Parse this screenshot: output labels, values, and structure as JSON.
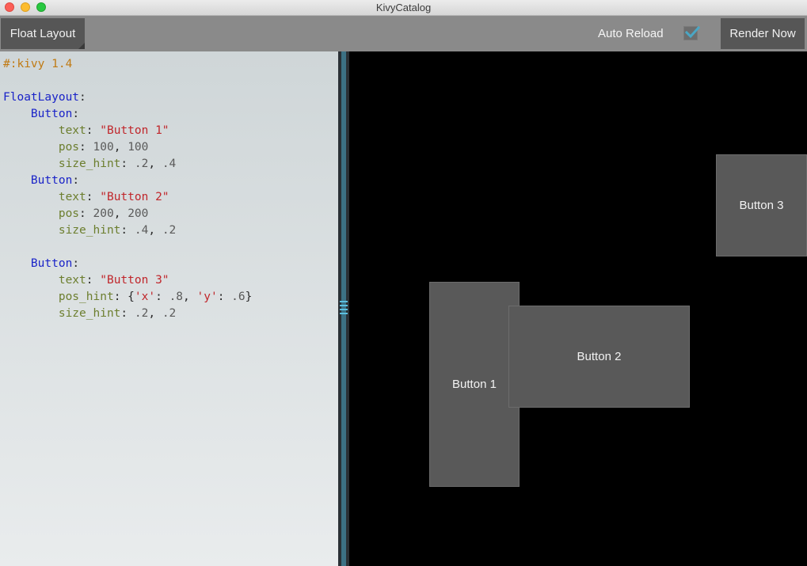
{
  "window": {
    "title": "KivyCatalog"
  },
  "toolbar": {
    "layout_button_label": "Float Layout",
    "auto_reload_label": "Auto Reload",
    "auto_reload_checked": true,
    "render_button_label": "Render Now"
  },
  "code": {
    "lines": [
      [
        {
          "t": "#:kivy 1.4",
          "c": "comment"
        }
      ],
      [],
      [
        {
          "t": "FloatLayout",
          "c": "class"
        },
        {
          "t": ":",
          "c": "plain"
        }
      ],
      [
        {
          "t": "    ",
          "c": "plain"
        },
        {
          "t": "Button",
          "c": "class"
        },
        {
          "t": ":",
          "c": "plain"
        }
      ],
      [
        {
          "t": "        ",
          "c": "plain"
        },
        {
          "t": "text",
          "c": "prop"
        },
        {
          "t": ": ",
          "c": "plain"
        },
        {
          "t": "\"Button 1\"",
          "c": "str"
        }
      ],
      [
        {
          "t": "        ",
          "c": "plain"
        },
        {
          "t": "pos",
          "c": "prop"
        },
        {
          "t": ": ",
          "c": "plain"
        },
        {
          "t": "100",
          "c": "num"
        },
        {
          "t": ", ",
          "c": "plain"
        },
        {
          "t": "100",
          "c": "num"
        }
      ],
      [
        {
          "t": "        ",
          "c": "plain"
        },
        {
          "t": "size_hint",
          "c": "prop"
        },
        {
          "t": ": ",
          "c": "plain"
        },
        {
          "t": ".2",
          "c": "num"
        },
        {
          "t": ", ",
          "c": "plain"
        },
        {
          "t": ".4",
          "c": "num"
        }
      ],
      [
        {
          "t": "    ",
          "c": "plain"
        },
        {
          "t": "Button",
          "c": "class"
        },
        {
          "t": ":",
          "c": "plain"
        }
      ],
      [
        {
          "t": "        ",
          "c": "plain"
        },
        {
          "t": "text",
          "c": "prop"
        },
        {
          "t": ": ",
          "c": "plain"
        },
        {
          "t": "\"Button 2\"",
          "c": "str"
        }
      ],
      [
        {
          "t": "        ",
          "c": "plain"
        },
        {
          "t": "pos",
          "c": "prop"
        },
        {
          "t": ": ",
          "c": "plain"
        },
        {
          "t": "200",
          "c": "num"
        },
        {
          "t": ", ",
          "c": "plain"
        },
        {
          "t": "200",
          "c": "num"
        }
      ],
      [
        {
          "t": "        ",
          "c": "plain"
        },
        {
          "t": "size_hint",
          "c": "prop"
        },
        {
          "t": ": ",
          "c": "plain"
        },
        {
          "t": ".4",
          "c": "num"
        },
        {
          "t": ", ",
          "c": "plain"
        },
        {
          "t": ".2",
          "c": "num"
        }
      ],
      [],
      [
        {
          "t": "    ",
          "c": "plain"
        },
        {
          "t": "Button",
          "c": "class"
        },
        {
          "t": ":",
          "c": "plain"
        }
      ],
      [
        {
          "t": "        ",
          "c": "plain"
        },
        {
          "t": "text",
          "c": "prop"
        },
        {
          "t": ": ",
          "c": "plain"
        },
        {
          "t": "\"Button 3\"",
          "c": "str"
        }
      ],
      [
        {
          "t": "        ",
          "c": "plain"
        },
        {
          "t": "pos_hint",
          "c": "prop"
        },
        {
          "t": ": {",
          "c": "plain"
        },
        {
          "t": "'x'",
          "c": "str"
        },
        {
          "t": ": ",
          "c": "plain"
        },
        {
          "t": ".8",
          "c": "num"
        },
        {
          "t": ", ",
          "c": "plain"
        },
        {
          "t": "'y'",
          "c": "str"
        },
        {
          "t": ": ",
          "c": "plain"
        },
        {
          "t": ".6",
          "c": "num"
        },
        {
          "t": "}",
          "c": "plain"
        }
      ],
      [
        {
          "t": "        ",
          "c": "plain"
        },
        {
          "t": "size_hint",
          "c": "prop"
        },
        {
          "t": ": ",
          "c": "plain"
        },
        {
          "t": ".2",
          "c": "num"
        },
        {
          "t": ", ",
          "c": "plain"
        },
        {
          "t": ".2",
          "c": "num"
        }
      ]
    ]
  },
  "preview": {
    "buttons": [
      {
        "label": "Button 1"
      },
      {
        "label": "Button 2"
      },
      {
        "label": "Button 3"
      }
    ]
  },
  "colors": {
    "toolbar_bg": "#8a8a8a",
    "button_bg": "#565656",
    "preview_bg": "#000000",
    "accent": "#4aa7c5"
  }
}
